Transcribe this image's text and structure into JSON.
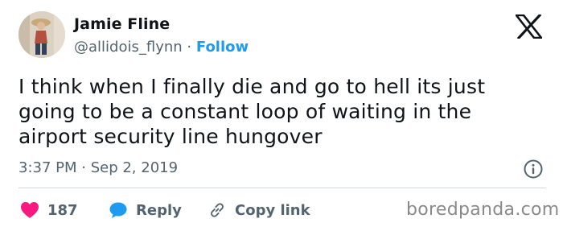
{
  "author": {
    "name": "Jamie Fline",
    "handle": "@allidois_flynn",
    "separator": "·",
    "follow_label": "Follow"
  },
  "tweet": {
    "text": "I think when I finally die and go to hell its just\ngoing to be a constant loop of waiting in the\nairport security line hungover",
    "timestamp": "3:37 PM · Sep 2, 2019"
  },
  "actions": {
    "likes_count": "187",
    "reply_label": "Reply",
    "copy_link_label": "Copy link"
  },
  "watermark": "boredpanda.com",
  "icons": {
    "logo": "x-logo-icon",
    "info": "info-icon",
    "like": "heart-icon",
    "reply": "speech-bubble-icon",
    "copy": "link-icon"
  },
  "colors": {
    "accent": "#1d9bf0",
    "like": "#f91880",
    "secondary_text": "#536471",
    "text": "#0f1419"
  }
}
